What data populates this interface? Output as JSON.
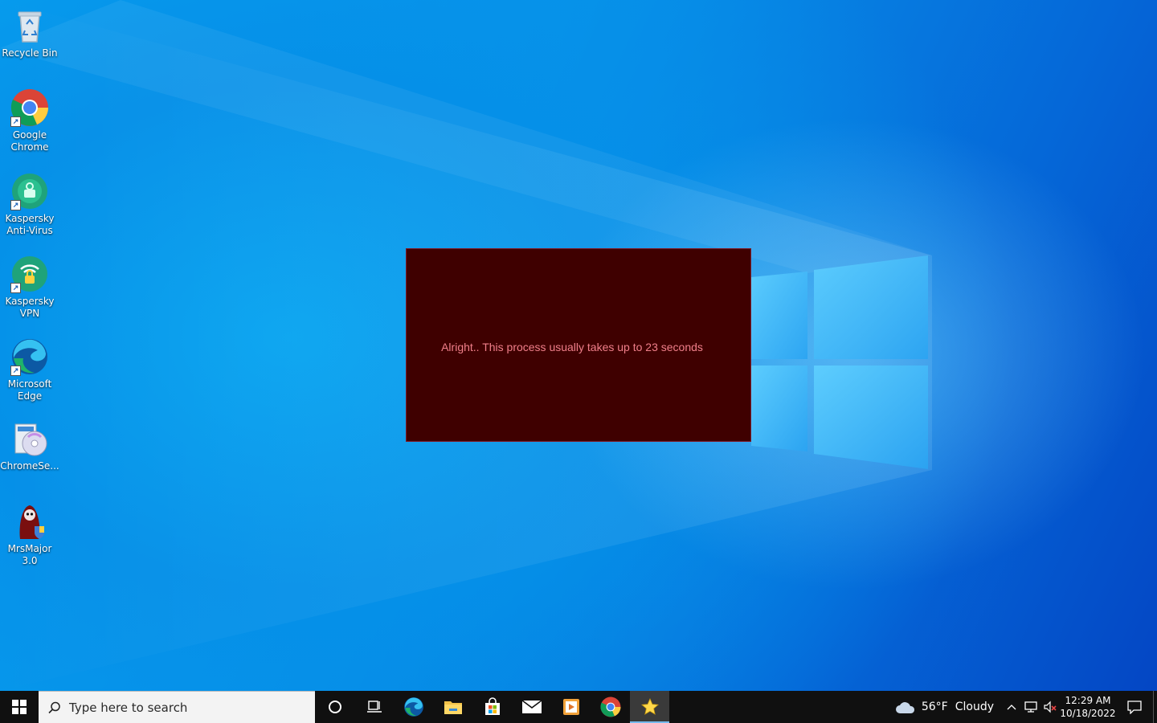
{
  "desktop": {
    "icons": [
      {
        "label": "Recycle Bin",
        "icon": "recycle-bin-icon"
      },
      {
        "label": "Google Chrome",
        "icon": "chrome-icon"
      },
      {
        "label": "Kaspersky Anti-Virus",
        "icon": "kaspersky-antivirus-icon"
      },
      {
        "label": "Kaspersky VPN",
        "icon": "kaspersky-vpn-icon"
      },
      {
        "label": "Microsoft Edge",
        "icon": "edge-icon"
      },
      {
        "label": "ChromeSe...",
        "icon": "installer-disc-icon"
      },
      {
        "label": "MrsMajor 3.0",
        "icon": "hooded-figure-icon"
      }
    ]
  },
  "dialog": {
    "message": "Alright.. This process usually takes up to 23 seconds",
    "background": "#3f0000",
    "text_color": "#f07f8a"
  },
  "taskbar": {
    "search_placeholder": "Type here to search",
    "pinned": [
      "cortana-icon",
      "task-view-icon",
      "edge-icon",
      "file-explorer-icon",
      "store-icon",
      "mail-icon",
      "media-player-icon",
      "chrome-icon",
      "star-app-icon"
    ],
    "active_app": "star-app-icon",
    "weather": {
      "temp": "56°F",
      "condition": "Cloudy"
    },
    "clock": {
      "time": "12:29 AM",
      "date": "10/18/2022"
    }
  },
  "colors": {
    "taskbar": "#101010",
    "wallpaper_blue": "#0793ea"
  }
}
